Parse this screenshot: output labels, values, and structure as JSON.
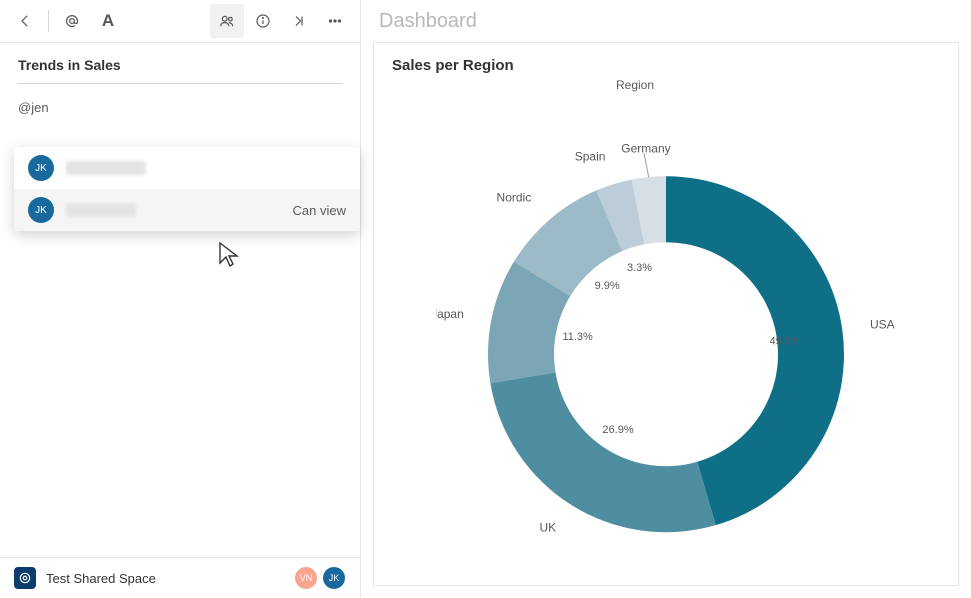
{
  "sidebar": {
    "panel_title": "Trends in Sales",
    "mention_text": "@jen",
    "dropdown": {
      "items": [
        {
          "initials": "JK",
          "permission": ""
        },
        {
          "initials": "JK",
          "permission": "Can view"
        }
      ]
    }
  },
  "footer": {
    "space_name": "Test Shared Space",
    "avatars": [
      {
        "initials": "VN"
      },
      {
        "initials": "JK"
      }
    ]
  },
  "main": {
    "header": "Dashboard",
    "chart_title": "Sales per Region",
    "legend_title": "Region"
  },
  "chart_data": {
    "type": "pie",
    "title": "Sales per Region",
    "series_name": "Region",
    "categories": [
      "USA",
      "UK",
      "Japan",
      "Nordic",
      "Spain",
      "Germany"
    ],
    "values": [
      45.5,
      26.9,
      11.3,
      9.9,
      3.3,
      3.1
    ],
    "colors": [
      "#0f6f87",
      "#4f8ea0",
      "#7aa6b6",
      "#9cbac8",
      "#bcccd8",
      "#d6dee6"
    ],
    "donut": true,
    "value_labels": [
      "45.5%",
      "26.9%",
      "11.3%",
      "9.9%",
      "3.3%"
    ]
  }
}
